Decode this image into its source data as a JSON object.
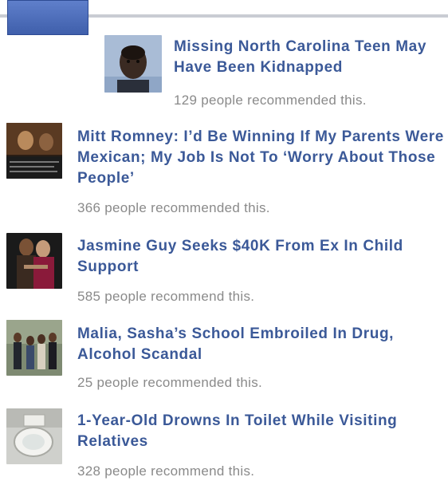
{
  "items": [
    {
      "title": "Missing North Carolina Teen May Have Been Kidnapped",
      "recommend_text": "129 people recommended this.",
      "thumb_icon": "portrait-photo"
    },
    {
      "title": "Mitt Romney: I’d Be Winning If My Parents Were Mexican; My Job Is Not To ‘Worry About Those People’",
      "recommend_text": "366 people recommended this.",
      "thumb_icon": "video-still-photo"
    },
    {
      "title": "Jasmine Guy Seeks $40K From Ex In Child Support",
      "recommend_text": "585 people recommend this.",
      "thumb_icon": "couple-photo"
    },
    {
      "title": "Malia, Sasha’s School Embroiled In Drug, Alcohol Scandal",
      "recommend_text": "25 people recommended this.",
      "thumb_icon": "family-walking-photo"
    },
    {
      "title": "1-Year-Old Drowns In Toilet While Visiting Relatives",
      "recommend_text": "328 people recommend this.",
      "thumb_icon": "toilet-photo"
    }
  ]
}
